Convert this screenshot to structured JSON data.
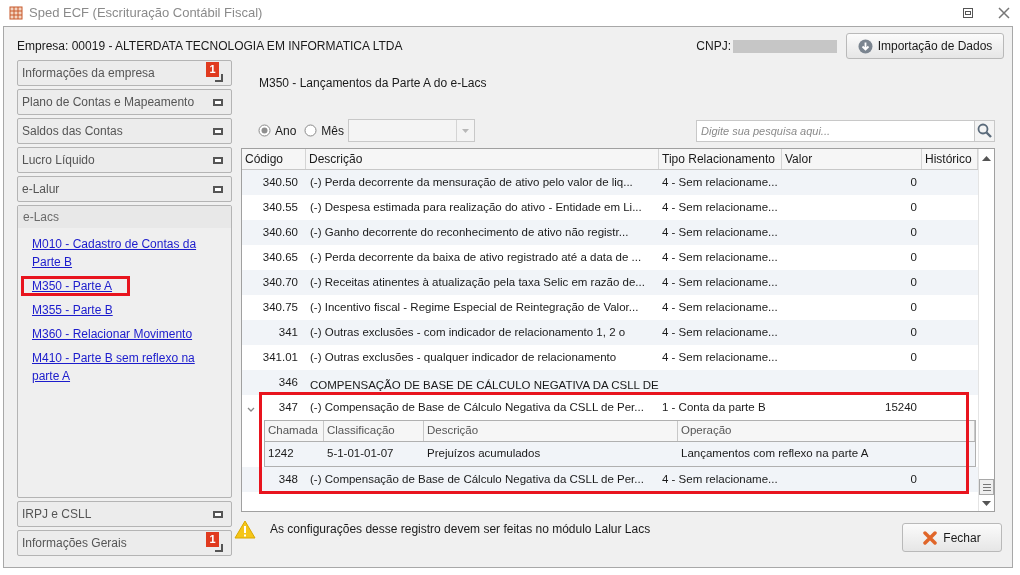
{
  "window": {
    "title": "Sped ECF (Escrituração Contábil Fiscal)"
  },
  "header": {
    "company": "Empresa: 00019 - ALTERDATA TECNOLOGIA EM INFORMATICA LTDA",
    "cnpj_label": "CNPJ:",
    "import_button": "Importação de Dados"
  },
  "sidebar": {
    "sections": [
      {
        "label": "Informações da empresa",
        "badge": "1",
        "expanded": false
      },
      {
        "label": "Plano de Contas e Mapeamento",
        "expanded": false
      },
      {
        "label": "Saldos das Contas",
        "expanded": false
      },
      {
        "label": "Lucro Líquido",
        "expanded": false
      },
      {
        "label": "e-Lalur",
        "expanded": false
      },
      {
        "label": "e-Lacs",
        "expanded": true,
        "links": [
          {
            "label": "M010 - Cadastro de Contas da Parte B",
            "highlighted": false
          },
          {
            "label": "M350 - Parte A",
            "highlighted": true
          },
          {
            "label": "M355 - Parte B",
            "highlighted": false
          },
          {
            "label": "M360 - Relacionar Movimento",
            "highlighted": false
          },
          {
            "label": "M410 - Parte B sem reflexo na parte A",
            "highlighted": false
          }
        ]
      },
      {
        "label": "IRPJ e CSLL",
        "expanded": false
      },
      {
        "label": "Informações Gerais",
        "badge": "1",
        "expanded": false
      }
    ]
  },
  "content": {
    "title": "M350 - Lançamentos da Parte A do e-Lacs",
    "period_options": [
      {
        "label": "Ano",
        "selected": true
      },
      {
        "label": "Mês",
        "selected": false
      }
    ],
    "search": {
      "placeholder": "Digite sua pesquisa aqui..."
    },
    "table": {
      "columns": [
        "Código",
        "Descrição",
        "Tipo Relacionamento",
        "Valor",
        "Histórico"
      ],
      "rows": [
        {
          "kind": "entry",
          "code": "340.50",
          "description": "(-) Perda decorrente da mensuração de ativo pelo valor de liq...",
          "relation": "4 - Sem relacioname...",
          "value": "0",
          "highlighted": false
        },
        {
          "kind": "entry",
          "code": "340.55",
          "description": "(-) Despesa estimada para realização do ativo - Entidade em Li...",
          "relation": "4 - Sem relacioname...",
          "value": "0",
          "highlighted": false
        },
        {
          "kind": "entry",
          "code": "340.60",
          "description": "(-) Ganho decorrente do reconhecimento de ativo não registr...",
          "relation": "4 - Sem relacioname...",
          "value": "0",
          "highlighted": false
        },
        {
          "kind": "entry",
          "code": "340.65",
          "description": "(-) Perda decorrente da baixa de ativo registrado até a data de ...",
          "relation": "4 - Sem relacioname...",
          "value": "0",
          "highlighted": false
        },
        {
          "kind": "entry",
          "code": "340.70",
          "description": "(-) Receitas atinentes à atualização pela taxa Selic em razão de...",
          "relation": "4 - Sem relacioname...",
          "value": "0",
          "highlighted": false
        },
        {
          "kind": "entry",
          "code": "340.75",
          "description": "(-) Incentivo fiscal - Regime Especial de Reintegração de Valor...",
          "relation": "4 - Sem relacioname...",
          "value": "0",
          "highlighted": false
        },
        {
          "kind": "entry",
          "code": "341",
          "description": "(-) Outras exclusões - com indicador de relacionamento 1, 2 o",
          "relation": "4 - Sem relacioname...",
          "value": "0",
          "highlighted": false
        },
        {
          "kind": "entry",
          "code": "341.01",
          "description": "(-) Outras exclusões - qualquer indicador de relacionamento",
          "relation": "4 - Sem relacioname...",
          "value": "0",
          "highlighted": false
        },
        {
          "kind": "title",
          "code": "346",
          "description": "COMPENSAÇÃO DE BASE DE CÁLCULO NEGATIVA DA CSLL DE",
          "highlighted": false
        },
        {
          "kind": "entry",
          "code": "347",
          "description": "(-) Compensação de Base de Cálculo Negativa da CSLL de Per...",
          "relation": "1 - Conta da parte B",
          "value": "15240",
          "highlighted": true,
          "expanded": true,
          "detail": {
            "columns": [
              "Chamada",
              "Classificação",
              "Descrição",
              "Operação"
            ],
            "rows": [
              [
                "1242",
                "5-1-01-01-07",
                "Prejuízos acumulados",
                "Lançamentos com reflexo na parte A"
              ]
            ]
          }
        },
        {
          "kind": "entry",
          "code": "348",
          "description": "(-) Compensação de Base de Cálculo Negativa da CSLL de Per...",
          "relation": "4 - Sem relacioname...",
          "value": "0",
          "highlighted": true
        }
      ]
    },
    "notice": "As configurações desse registro devem ser feitas no módulo Lalur Lacs",
    "close_button": "Fechar"
  }
}
